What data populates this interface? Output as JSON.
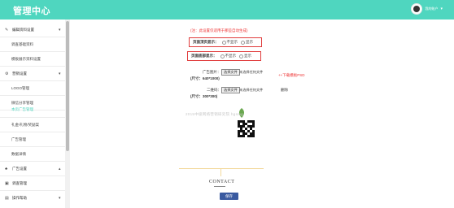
{
  "header": {
    "app_title": "管理中心",
    "user_name": "我的账户",
    "caret": "▾"
  },
  "sidebar": {
    "groups": [
      {
        "icon": "✎",
        "label": "编辑资料设置",
        "caret": "▾"
      },
      {
        "icon": "⚙",
        "label": "营销设置",
        "caret": "▾"
      },
      {
        "icon": "♣",
        "label": "广告设置",
        "caret": "▴"
      },
      {
        "icon": "▣",
        "label": "调查管理",
        "caret": ""
      },
      {
        "icon": "▤",
        "label": "操作帮助",
        "caret": "▾"
      }
    ],
    "subitems": [
      {
        "label": "调查基础资料"
      },
      {
        "label": "模板展示资料设置"
      },
      {
        "label": "LOGO管理"
      },
      {
        "label": "微信分享管理"
      },
      {
        "label": "本页广告管理"
      },
      {
        "label": "礼金/礼物/奖励案"
      },
      {
        "label": "广告管理"
      },
      {
        "label": "数据详情"
      }
    ]
  },
  "form": {
    "note": "(注：此设置仅适用于那些自动生成)",
    "top_ad": {
      "label": "页面顶页显示：",
      "opt_hide": "不显示",
      "opt_show": "显示"
    },
    "bottom_ad": {
      "label": "页面底部显示：",
      "opt_hide": "不显示",
      "opt_show": "显示"
    },
    "ad_image": {
      "label": "广告图片：",
      "size_text": "(尺寸：640*1000)",
      "choose_btn": "选择文件",
      "file_status": "未选择任何文件",
      "hint": "++下载模板PSD"
    },
    "qr_image": {
      "label": "二维码：",
      "size_text": "(尺寸：300*300)",
      "choose_btn": "选择文件",
      "file_status": "未选择任何文件",
      "delete": "删除"
    },
    "watermark": "2015中级网络营销研究院 hgsmg",
    "contact": "CONTACT",
    "save_label": "保存"
  },
  "colors": {
    "accent": "#4fd6bf",
    "warning": "#e33333",
    "primary_button": "#3a5aa0"
  }
}
